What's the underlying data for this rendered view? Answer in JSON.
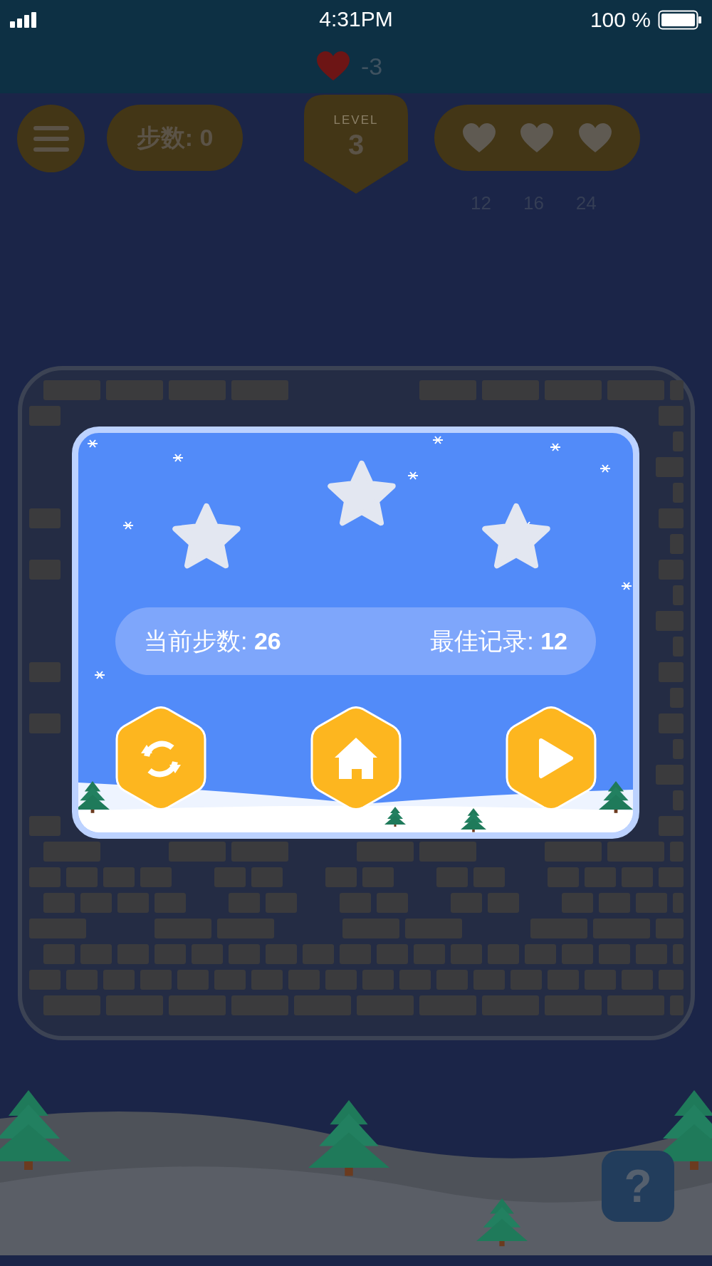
{
  "status_bar": {
    "time": "4:31PM",
    "battery": "100 %"
  },
  "banner": {
    "penalty": "-3"
  },
  "top_bar": {
    "steps": "步数: 0",
    "level_label": "LEVEL",
    "level": "3",
    "thresholds": [
      "12",
      "16",
      "24"
    ]
  },
  "dialog": {
    "stars": 0,
    "current_steps": "当前步数: **26**",
    "best_record": "最佳记录: **12**",
    "buttons": [
      {
        "kind": "restart"
      },
      {
        "kind": "home"
      },
      {
        "kind": "next"
      }
    ]
  },
  "help_button": {
    "label": "?"
  }
}
